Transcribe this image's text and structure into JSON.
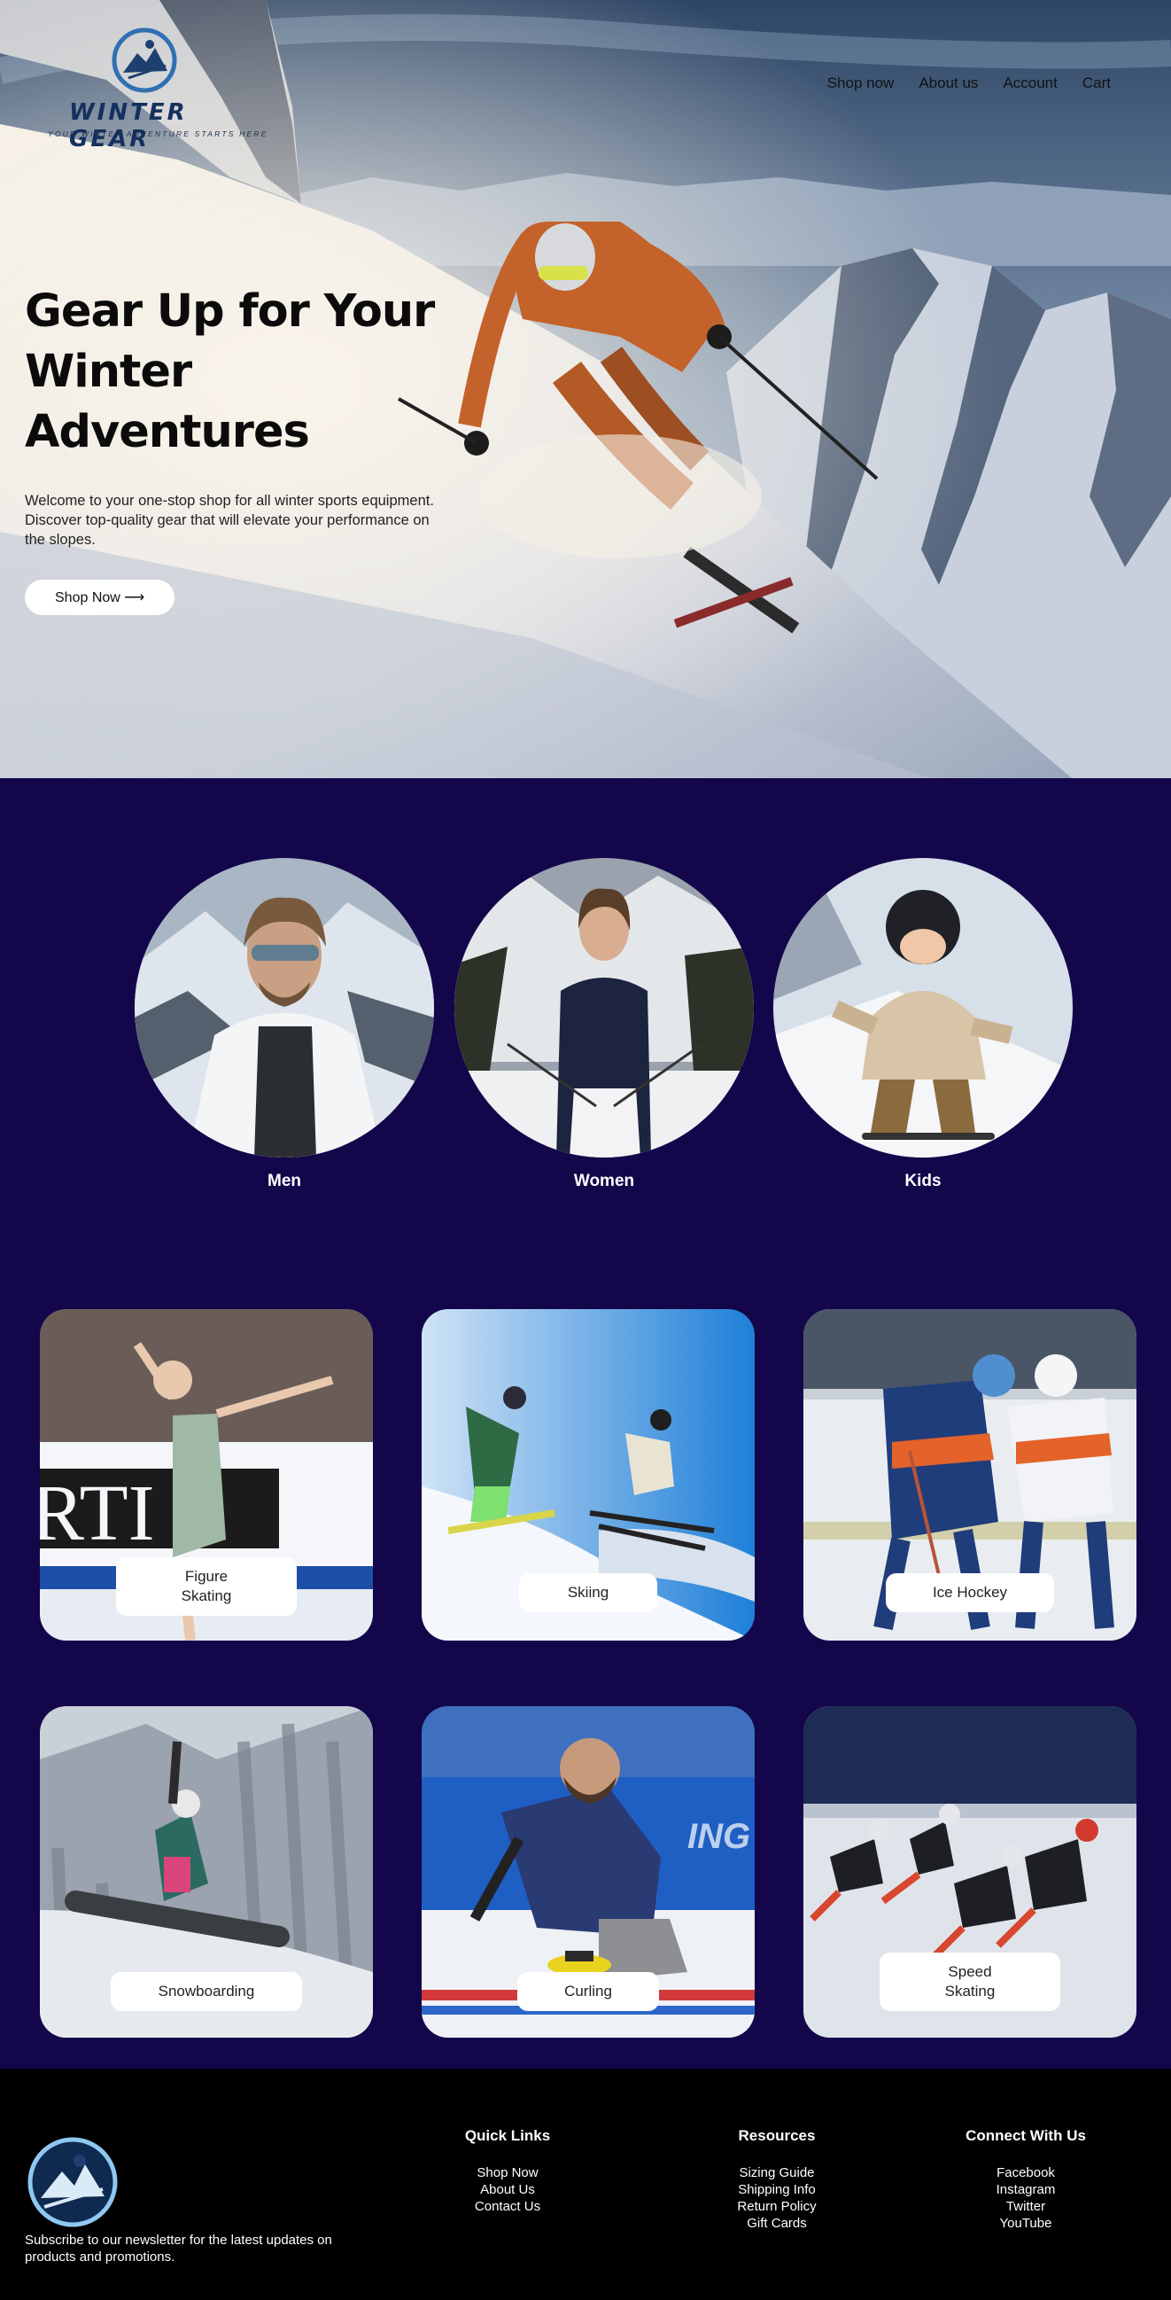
{
  "header": {
    "brand": "WINTER GEAR",
    "tagline": "YOUR WINTER ADVENTURE STARTS HERE",
    "nav": [
      "Shop now",
      "About us",
      "Account",
      "Cart"
    ]
  },
  "hero": {
    "title_line1": "Gear Up for Your",
    "title_line2": "Winter Adventures",
    "subtitle": "Welcome to your one-stop shop for all winter sports equipment. Discover top-quality gear that will elevate your performance on the slopes.",
    "button": "Shop Now ⟶"
  },
  "categories": [
    {
      "label": "Men"
    },
    {
      "label": "Women"
    },
    {
      "label": "Kids"
    }
  ],
  "sports": [
    {
      "line1": "Figure",
      "line2": "Skating"
    },
    {
      "line1": "Skiing",
      "line2": ""
    },
    {
      "line1": "Ice Hockey",
      "line2": ""
    },
    {
      "line1": "Snowboarding",
      "line2": ""
    },
    {
      "line1": "Curling",
      "line2": ""
    },
    {
      "line1": "Speed",
      "line2": "Skating"
    }
  ],
  "footer": {
    "newsletter": "Subscribe to our newsletter for the latest updates on products and promotions.",
    "quick_links": {
      "title": "Quick Links",
      "items": [
        "Shop Now",
        "About Us",
        "Contact Us"
      ]
    },
    "resources": {
      "title": "Resources",
      "items": [
        "Sizing Guide",
        "Shipping Info",
        "Return Policy",
        "Gift Cards"
      ]
    },
    "connect": {
      "title": "Connect With Us",
      "items": [
        "Facebook",
        "Instagram",
        "Twitter",
        "YouTube"
      ]
    }
  },
  "colors": {
    "page_bg": "#13064a",
    "footer_bg": "#000000",
    "text_on_dark": "#ffffff"
  }
}
